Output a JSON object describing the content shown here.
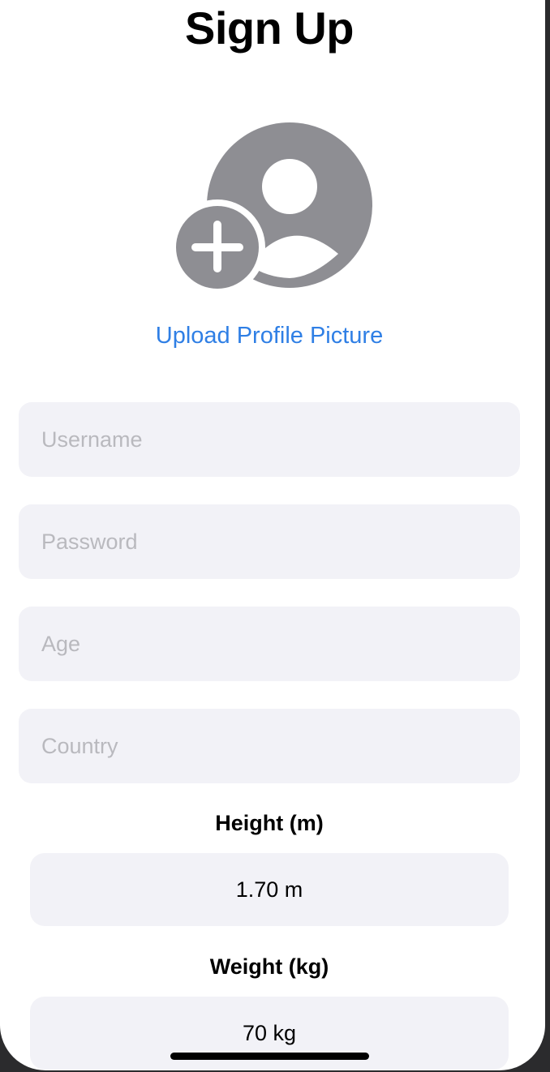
{
  "header": {
    "title": "Sign Up"
  },
  "profile": {
    "icon": "person-crop-circle-badge-plus-icon",
    "icon_color": "#8e8e93",
    "upload_label": "Upload Profile Picture",
    "link_color": "#2f7fe5"
  },
  "form": {
    "username_placeholder": "Username",
    "password_placeholder": "Password",
    "age_placeholder": "Age",
    "country_placeholder": "Country",
    "field_background": "#f2f2f7"
  },
  "height": {
    "label": "Height (m)",
    "value": "1.70 m"
  },
  "weight": {
    "label": "Weight (kg)",
    "value": "70 kg"
  }
}
